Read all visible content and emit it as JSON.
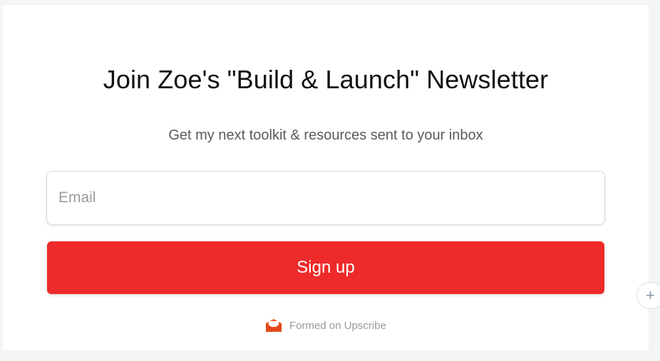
{
  "newsletter": {
    "title": "Join Zoe's \"Build & Launch\" Newsletter",
    "subtitle": "Get my next toolkit & resources sent to your inbox",
    "email_placeholder": "Email",
    "signup_label": "Sign up",
    "footer_text": "Formed on Upscribe",
    "footer_icon": "envelope-icon"
  },
  "side_widget": {
    "icon": "plus-icon",
    "glyph": "+"
  },
  "colors": {
    "button_bg": "#ee2a2a",
    "button_text": "#ffffff",
    "envelope": "#f15a24",
    "page_bg": "#f4f5f7"
  }
}
